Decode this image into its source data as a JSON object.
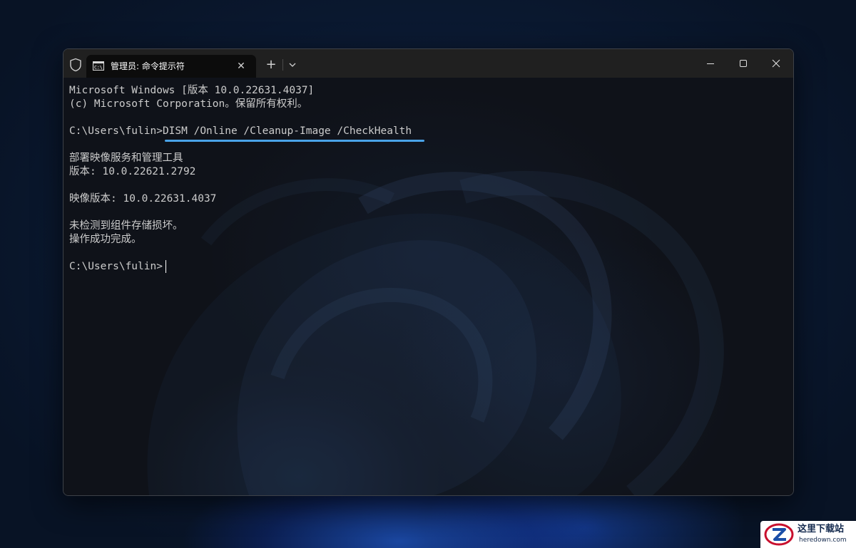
{
  "window": {
    "tab_title": "管理员: 命令提示符",
    "icons": {
      "shield": "shield-icon",
      "tab": "command-prompt-icon",
      "close_tab": "close-icon",
      "new_tab": "plus-icon",
      "dropdown": "chevron-down-icon",
      "minimize": "minimize-icon",
      "maximize": "maximize-icon",
      "close": "close-icon"
    }
  },
  "terminal": {
    "lines": [
      "Microsoft Windows [版本 10.0.22631.4037]",
      "(c) Microsoft Corporation。保留所有权利。",
      "",
      "C:\\Users\\fulin>DISM /Online /Cleanup-Image /CheckHealth",
      "",
      "部署映像服务和管理工具",
      "版本: 10.0.22621.2792",
      "",
      "映像版本: 10.0.22631.4037",
      "",
      "未检测到组件存储损坏。",
      "操作成功完成。",
      "",
      "C:\\Users\\fulin>"
    ],
    "highlighted_command": "DISM /Online /Cleanup-Image /CheckHealth",
    "highlight_color": "#4aa3e8"
  },
  "watermark": {
    "title": "这里下载站",
    "subtitle": "heredown.com"
  }
}
